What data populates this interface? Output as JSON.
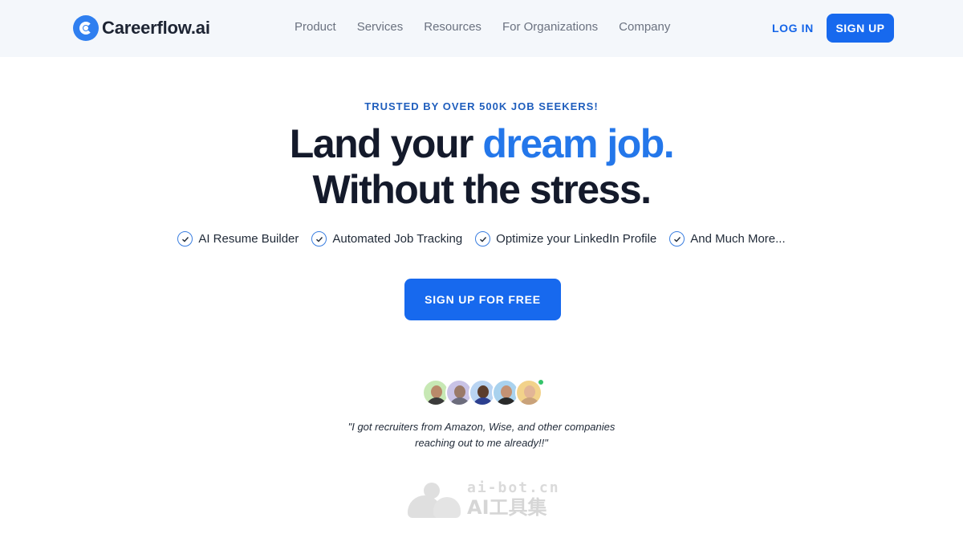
{
  "header": {
    "brand": "Careerflow.ai",
    "nav": [
      "Product",
      "Services",
      "Resources",
      "For Organizations",
      "Company"
    ],
    "login_label": "LOG IN",
    "signup_label": "SIGN UP"
  },
  "hero": {
    "eyebrow": "TRUSTED BY OVER 500K JOB SEEKERS!",
    "headline_line1_plain": "Land your ",
    "headline_line1_accent": "dream job.",
    "headline_line2": "Without the stress.",
    "features": [
      "AI Resume Builder",
      "Automated Job Tracking",
      "Optimize your LinkedIn Profile",
      "And Much More..."
    ],
    "cta_label": "SIGN UP FOR FREE"
  },
  "testimonial": {
    "quote_line1": "\"I got recruiters from Amazon, Wise, and other companies",
    "quote_line2": "reaching out to me already!!\""
  },
  "watermark": {
    "top": "ai-bot.cn",
    "bottom": "AI工具集"
  },
  "colors": {
    "primary": "#1769ee",
    "accent_text": "#2477ea",
    "header_bg": "#f4f7fb",
    "headline": "#141a2b",
    "online": "#34c46a"
  }
}
